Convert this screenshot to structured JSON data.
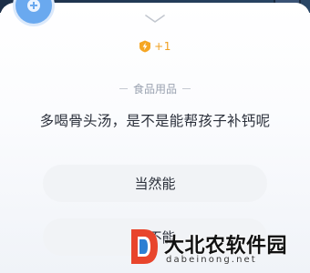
{
  "icons": {
    "top_left": "add-icon",
    "collapse": "chevron-down-icon",
    "reward": "lightning-badge-icon",
    "watermark_logo": "site-logo-icon"
  },
  "colors": {
    "accent_blue": "#6aa9ef",
    "reward_orange": "#f0a020",
    "text_primary": "#2a2f3a",
    "text_muted": "#9aa2b0",
    "option_bg": "#f1f3f6"
  },
  "reward": {
    "text": "+1"
  },
  "quiz": {
    "category": "食品用品",
    "question": "多喝骨头汤，是不是能帮孩子补钙呢",
    "options": [
      {
        "label": "当然能"
      },
      {
        "label": "并不能"
      }
    ]
  },
  "watermark": {
    "title": "大北农软件园",
    "subtitle": "dabeinong.net"
  }
}
